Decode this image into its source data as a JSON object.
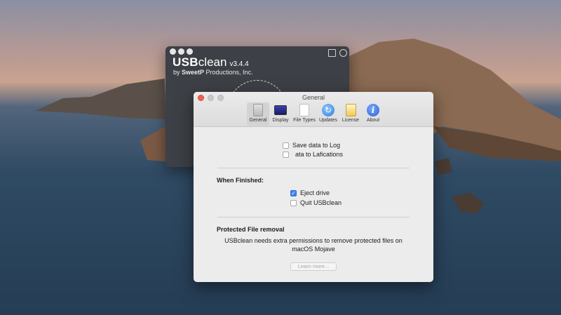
{
  "back_window": {
    "logo_bold": "USB",
    "logo_light": "clean",
    "version": "v3.4.4",
    "by_prefix": "by ",
    "company_bold": "SweetP",
    "company_rest": " Productions, Inc."
  },
  "prefs_window": {
    "title": "General",
    "toolbar": [
      {
        "label": "General",
        "icon": "general-switch-icon",
        "active": true
      },
      {
        "label": "Display",
        "icon": "display-monitor-icon",
        "active": false
      },
      {
        "label": "File Types",
        "icon": "file-document-icon",
        "active": false
      },
      {
        "label": "Updates",
        "icon": "refresh-arrows-icon",
        "active": false
      },
      {
        "label": "License",
        "icon": "certificate-icon",
        "active": false
      },
      {
        "label": "About",
        "icon": "info-icon",
        "active": false
      }
    ],
    "log_options": [
      {
        "label": "Save data to Log",
        "checked": false
      },
      {
        "label": "ata to Lafications",
        "checked": false
      }
    ],
    "when_finished": {
      "title": "When Finished:",
      "options": [
        {
          "label": "Eject drive",
          "checked": true
        },
        {
          "label": "Quit USBclean",
          "checked": false
        }
      ]
    },
    "protected": {
      "title": "Protected File removal",
      "note": "USBclean needs extra permissions to remove protected files on macOS Mojave",
      "button": "Learn more..."
    }
  },
  "colors": {
    "accent": "#3b83f0",
    "close": "#ee5f56"
  }
}
